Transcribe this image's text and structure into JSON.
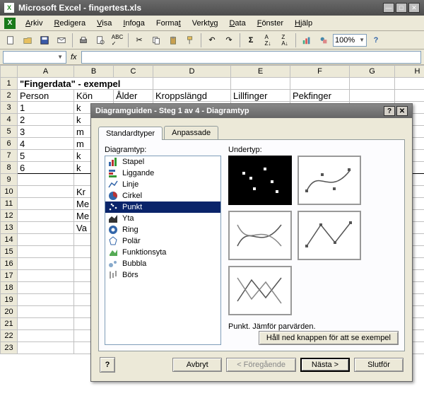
{
  "window": {
    "title": "Microsoft Excel - fingertest.xls"
  },
  "menu": {
    "items": [
      "Arkiv",
      "Redigera",
      "Visa",
      "Infoga",
      "Format",
      "Verktyg",
      "Data",
      "Fönster",
      "Hjälp"
    ]
  },
  "toolbar": {
    "zoom": "100%"
  },
  "formula": {
    "namebox": "",
    "fx": "fx"
  },
  "columns": [
    "A",
    "B",
    "C",
    "D",
    "E",
    "F",
    "G",
    "H"
  ],
  "rows_visible": 23,
  "cells": {
    "A1": "\"Fingerdata\" - exempel",
    "A2": "Person",
    "B2": "Kön",
    "C2": "Ålder",
    "D2": "Kroppslängd",
    "E2": "Lillfinger",
    "F2": "Pekfinger",
    "A3": "1",
    "B3": "k",
    "A4": "2",
    "B4": "k",
    "A5": "3",
    "B5": "m",
    "A6": "4",
    "B6": "m",
    "A7": "5",
    "B7": "k",
    "A8": "6",
    "B8": "k",
    "B10": "Kr",
    "B11": "Me",
    "B12": "Me",
    "B13": "Va"
  },
  "dialog": {
    "title": "Diagramguiden - Steg 1 av 4 - Diagramtyp",
    "tabs": {
      "standard": "Standardtyper",
      "custom": "Anpassade"
    },
    "labels": {
      "type": "Diagramtyp:",
      "subtype": "Undertyp:"
    },
    "types": [
      "Stapel",
      "Liggande",
      "Linje",
      "Cirkel",
      "Punkt",
      "Yta",
      "Ring",
      "Polär",
      "Funktionsyta",
      "Bubbla",
      "Börs"
    ],
    "selected_type_index": 4,
    "description": "Punkt. Jämför parvärden.",
    "preview_button": "Håll ned knappen för att se exempel",
    "buttons": {
      "help": "?",
      "cancel": "Avbryt",
      "back": "< Föregående",
      "next": "Nästa >",
      "finish": "Slutför"
    }
  }
}
